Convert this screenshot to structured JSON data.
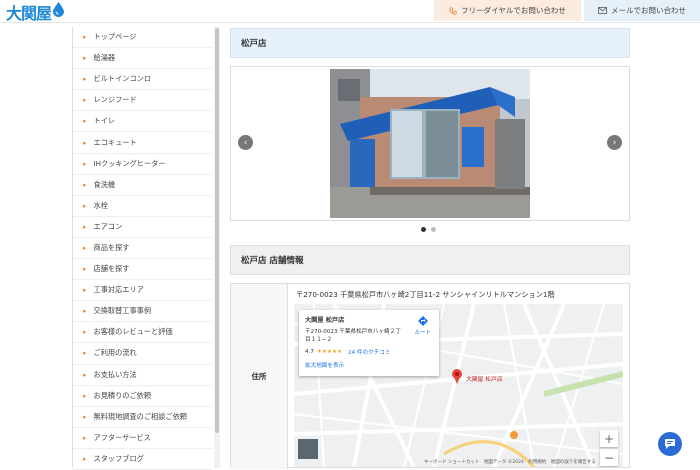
{
  "header": {
    "logo_text": "大関屋",
    "call_label": "フリーダイヤルでお問い合わせ",
    "mail_label": "メールでお問い合わせ"
  },
  "sidebar": {
    "items": [
      {
        "label": "トップページ"
      },
      {
        "label": "給湯器"
      },
      {
        "label": "ビルトインコンロ"
      },
      {
        "label": "レンジフード"
      },
      {
        "label": "トイレ"
      },
      {
        "label": "エコキュート"
      },
      {
        "label": "IHクッキングヒーター"
      },
      {
        "label": "食洗機"
      },
      {
        "label": "水栓"
      },
      {
        "label": "エアコン"
      },
      {
        "label": "商品を探す"
      },
      {
        "label": "店舗を探す"
      },
      {
        "label": "工事対応エリア"
      },
      {
        "label": "交換取替工事事例"
      },
      {
        "label": "お客様のレビューと評価"
      },
      {
        "label": "ご利用の流れ"
      },
      {
        "label": "お支払い方法"
      },
      {
        "label": "お見積りのご依頼"
      },
      {
        "label": "無料現地調査のご相談ご依頼"
      },
      {
        "label": "アフターサービス"
      },
      {
        "label": "スタッフブログ"
      }
    ]
  },
  "main": {
    "store_title": "松戸店",
    "info_title": "松戸店 店舗情報",
    "address_label": "住所",
    "address": "〒270-0023 千葉県松戸市八ヶ崎2丁目11-2 サンシャインリトルマンション1階"
  },
  "map": {
    "card_name": "大関屋 松戸店",
    "card_address": "〒270-0023 千葉県松戸市八ヶ崎２丁目１１−２",
    "route_label": "ルート",
    "rating_value": "4.7",
    "stars": "★★★★★",
    "reviews": "24 件のクチコミ",
    "bigmap_label": "拡大地図を表示",
    "pin_label": "大関屋 松戸店",
    "zoom_in": "+",
    "zoom_out": "−",
    "footer": "キーボード ショートカット　地図データ ©2024　利用規約　地図の誤りを報告する"
  },
  "carousel": {
    "prev": "‹",
    "next": "›",
    "slides": 2,
    "active": 0
  }
}
